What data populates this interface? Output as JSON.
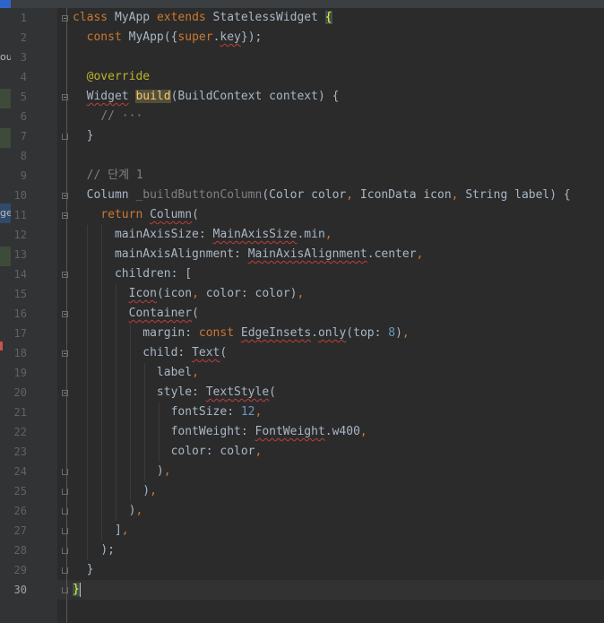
{
  "left_strip": {
    "peek_texts": [
      "ou",
      "ge"
    ]
  },
  "editor": {
    "language": "dart",
    "current_line": 30,
    "lines": [
      {
        "n": "1"
      },
      {
        "n": "2"
      },
      {
        "n": "3"
      },
      {
        "n": "4"
      },
      {
        "n": "5"
      },
      {
        "n": "6"
      },
      {
        "n": "7"
      },
      {
        "n": "8"
      },
      {
        "n": "9"
      },
      {
        "n": "10"
      },
      {
        "n": "11"
      },
      {
        "n": "12"
      },
      {
        "n": "13"
      },
      {
        "n": "14"
      },
      {
        "n": "15"
      },
      {
        "n": "16"
      },
      {
        "n": "17"
      },
      {
        "n": "18"
      },
      {
        "n": "19"
      },
      {
        "n": "20"
      },
      {
        "n": "21"
      },
      {
        "n": "22"
      },
      {
        "n": "23"
      },
      {
        "n": "24"
      },
      {
        "n": "25"
      },
      {
        "n": "26"
      },
      {
        "n": "27"
      },
      {
        "n": "28"
      },
      {
        "n": "29"
      },
      {
        "n": "30"
      }
    ],
    "code": {
      "l1": {
        "kw1": "class",
        "name": " MyApp ",
        "kw2": "extends",
        "type": " StatelessWidget ",
        "brace": "{"
      },
      "l2": {
        "indent": "  ",
        "kw": "const",
        "text1": " MyApp({",
        "kw2": "super",
        "text2": ".",
        "field": "key",
        "text3": "});"
      },
      "l4": {
        "indent": "  ",
        "at": "@",
        "ann": "override"
      },
      "l5": {
        "indent": "  ",
        "type": "Widget",
        "sp": " ",
        "fn": "build",
        "args": "(BuildContext context) {"
      },
      "l6": {
        "indent": "    ",
        "comment": "// ···"
      },
      "l7": {
        "indent": "  ",
        "text": "}"
      },
      "l9": {
        "indent": "  ",
        "comment": "// 단계 1"
      },
      "l10": {
        "indent": "  ",
        "t1": "Column ",
        "fn": "_buildButtonColumn",
        "t2": "(Color color",
        "c1": ",",
        "t3": " IconData icon",
        "c2": ",",
        "t4": " String label) {"
      },
      "l11": {
        "indent": "    ",
        "kw": "return",
        "t1": " ",
        "cls": "Column",
        "t2": "("
      },
      "l12": {
        "indent": "      ",
        "t1": "mainAxisSize: ",
        "cls": "MainAxisSize",
        "t2": ".min",
        "c": ","
      },
      "l13": {
        "indent": "      ",
        "t1": "mainAxisAlignment: ",
        "cls": "MainAxisAlignment",
        "t2": ".center",
        "c": ","
      },
      "l14": {
        "indent": "      ",
        "t1": "children: ["
      },
      "l15": {
        "indent": "        ",
        "cls": "Icon",
        "t1": "(icon",
        "c1": ",",
        "t2": " color: color)",
        "c2": ","
      },
      "l16": {
        "indent": "        ",
        "cls": "Container",
        "t1": "("
      },
      "l17": {
        "indent": "          ",
        "t1": "margin: ",
        "kw": "const",
        "t2": " ",
        "cls": "EdgeInsets",
        "t3": ".",
        "fn": "only",
        "t4": "(top: ",
        "num": "8",
        "t5": ")",
        "c": ","
      },
      "l18": {
        "indent": "          ",
        "t1": "child: ",
        "cls": "Text",
        "t2": "("
      },
      "l19": {
        "indent": "            ",
        "t1": "label",
        "c": ","
      },
      "l20": {
        "indent": "            ",
        "t1": "style: ",
        "cls": "TextStyle",
        "t2": "("
      },
      "l21": {
        "indent": "              ",
        "t1": "fontSize: ",
        "num": "12",
        "c": ","
      },
      "l22": {
        "indent": "              ",
        "t1": "fontWeight: ",
        "cls": "FontWeight",
        "t2": ".w400",
        "c": ","
      },
      "l23": {
        "indent": "              ",
        "t1": "color: color",
        "c": ","
      },
      "l24": {
        "indent": "            ",
        "t1": ")",
        "c": ","
      },
      "l25": {
        "indent": "          ",
        "t1": ")",
        "c": ","
      },
      "l26": {
        "indent": "        ",
        "t1": ")",
        "c": ","
      },
      "l27": {
        "indent": "      ",
        "t1": "]",
        "c": ","
      },
      "l28": {
        "indent": "    ",
        "t1": ");"
      },
      "l29": {
        "indent": "  ",
        "t1": "}"
      },
      "l30": {
        "brace": "}"
      }
    }
  }
}
